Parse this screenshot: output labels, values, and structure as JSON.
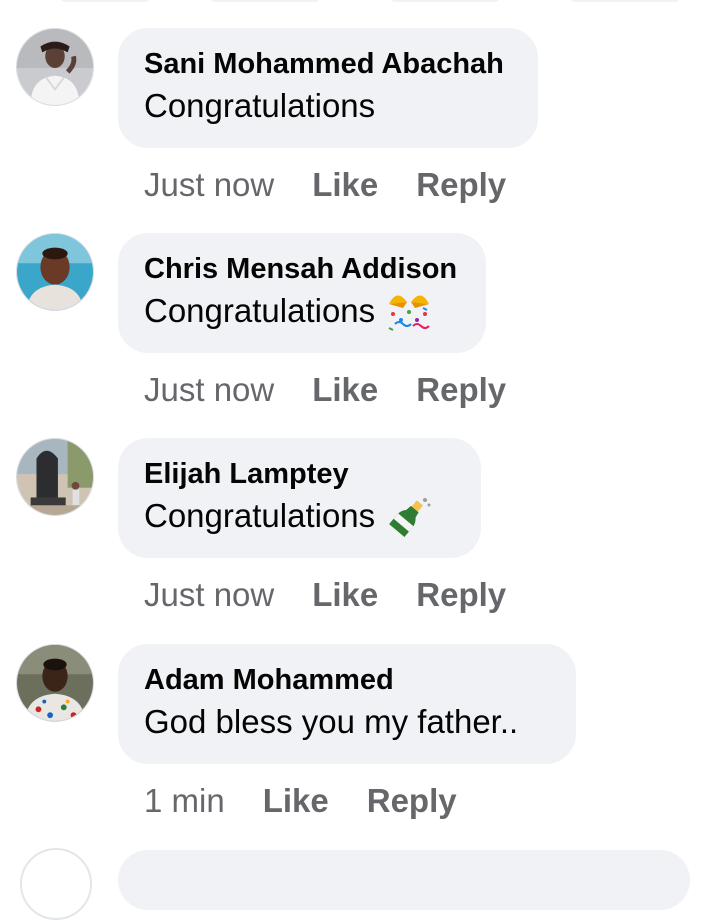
{
  "comments": [
    {
      "author": "Sani Mohammed Abachah",
      "text": "Congratulations",
      "emoji": "",
      "time": "Just now",
      "like_label": "Like",
      "reply_label": "Reply"
    },
    {
      "author": "Chris Mensah Addison",
      "text": "Congratulations",
      "emoji": "party-popper-emoji",
      "time": "Just now",
      "like_label": "Like",
      "reply_label": "Reply"
    },
    {
      "author": "Elijah Lamptey",
      "text": "Congratulations",
      "emoji": "champagne-bottle-emoji",
      "time": "Just now",
      "like_label": "Like",
      "reply_label": "Reply"
    },
    {
      "author": "Adam Mohammed",
      "text": "God bless you my father..",
      "emoji": "",
      "time": "1 min",
      "like_label": "Like",
      "reply_label": "Reply"
    }
  ],
  "colors": {
    "bubble_bg": "#f0f2f5",
    "primary_text": "#050505",
    "secondary_text": "#65676b"
  }
}
